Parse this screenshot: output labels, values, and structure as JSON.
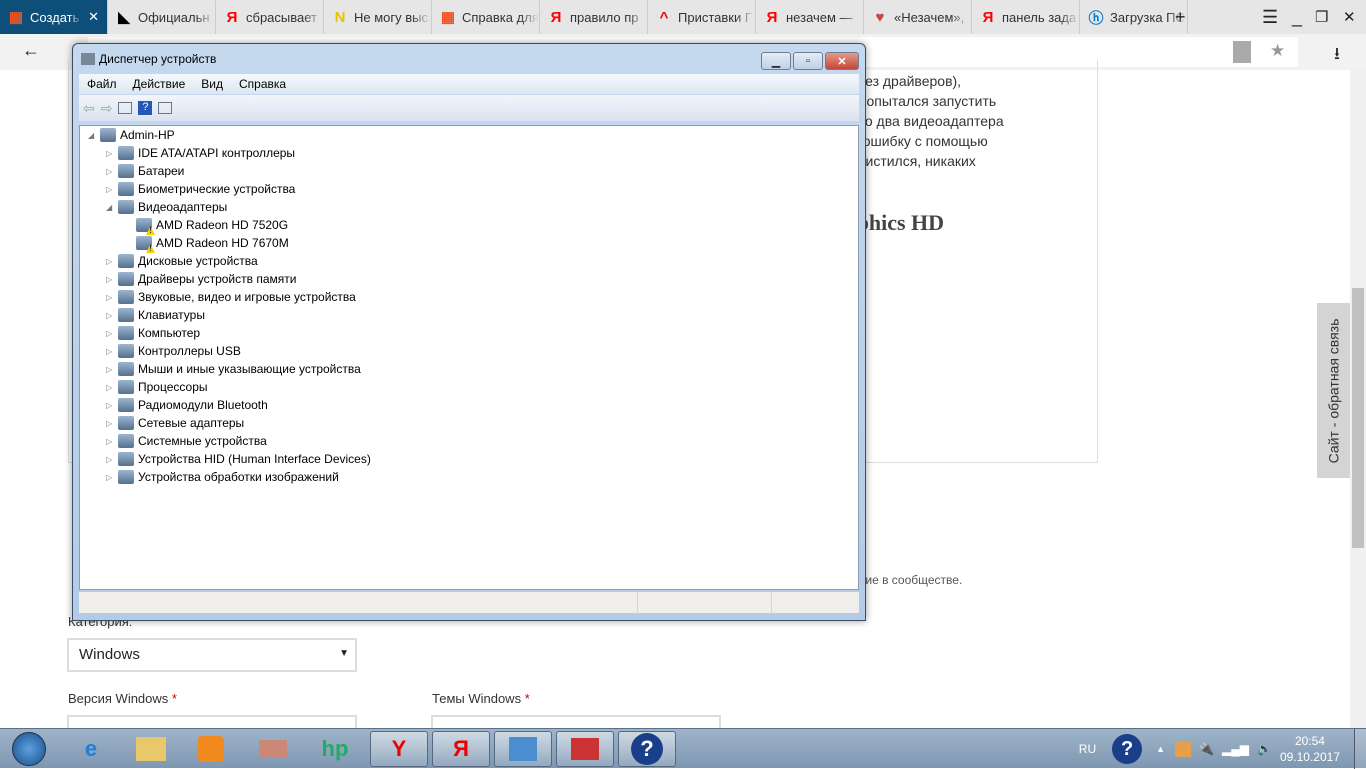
{
  "browser": {
    "tabs": [
      {
        "label": "Создать н",
        "icon": "microsoft-icon",
        "active": true
      },
      {
        "label": "Официальн",
        "icon": "amd-icon"
      },
      {
        "label": "сбрасывает",
        "icon": "yandex-icon"
      },
      {
        "label": "Не могу выс",
        "icon": "n-icon"
      },
      {
        "label": "Справка для",
        "icon": "microsoft-icon"
      },
      {
        "label": "правило пр",
        "icon": "yandex-icon"
      },
      {
        "label": "Приставки Г",
        "icon": "caret-icon"
      },
      {
        "label": "незачем —",
        "icon": "yandex-icon"
      },
      {
        "label": "«Незачем»,",
        "icon": "abc-icon"
      },
      {
        "label": "панель зада",
        "icon": "yandex-icon"
      },
      {
        "label": "Загрузка ПС",
        "icon": "hp-icon"
      }
    ],
    "close_tab": "✕",
    "new_tab": "+",
    "menu": "☰",
    "minimize": "_",
    "restore": "❐",
    "close": "✕",
    "back": "←",
    "star": "★",
    "download": "⭳"
  },
  "page": {
    "lines": [
      "лая, а как без драйверов),",
      "\". После я попытался запустить",
      "заметил, что два видеоадаптера",
      "равить эту ошибку с помощью",
      "збирался, чистился, никаких"
    ],
    "heading": "on Graphics HD",
    "discussion": "ать обсуждение в сообществе.",
    "category_label": "Категория:",
    "category_value": "Windows",
    "version_label": "Версия Windows",
    "themes_label": "Темы Windows",
    "required": "*",
    "feedback": "Сайт - обратная связь"
  },
  "devmgr": {
    "title": "Диспетчер устройств",
    "menu": [
      "Файл",
      "Действие",
      "Вид",
      "Справка"
    ],
    "root": "Admin-HP",
    "categories": [
      "IDE ATA/ATAPI контроллеры",
      "Батареи",
      "Биометрические устройства",
      "Видеоадаптеры",
      "Дисковые устройства",
      "Драйверы устройств памяти",
      "Звуковые, видео и игровые устройства",
      "Клавиатуры",
      "Компьютер",
      "Контроллеры USB",
      "Мыши и иные указывающие устройства",
      "Процессоры",
      "Радиомодули Bluetooth",
      "Сетевые адаптеры",
      "Системные устройства",
      "Устройства HID (Human Interface Devices)",
      "Устройства обработки изображений"
    ],
    "video_children": [
      "AMD Radeon HD 7520G",
      "AMD Radeon HD 7670M"
    ]
  },
  "taskbar": {
    "lang": "RU",
    "time": "20:54",
    "date": "09.10.2017"
  }
}
